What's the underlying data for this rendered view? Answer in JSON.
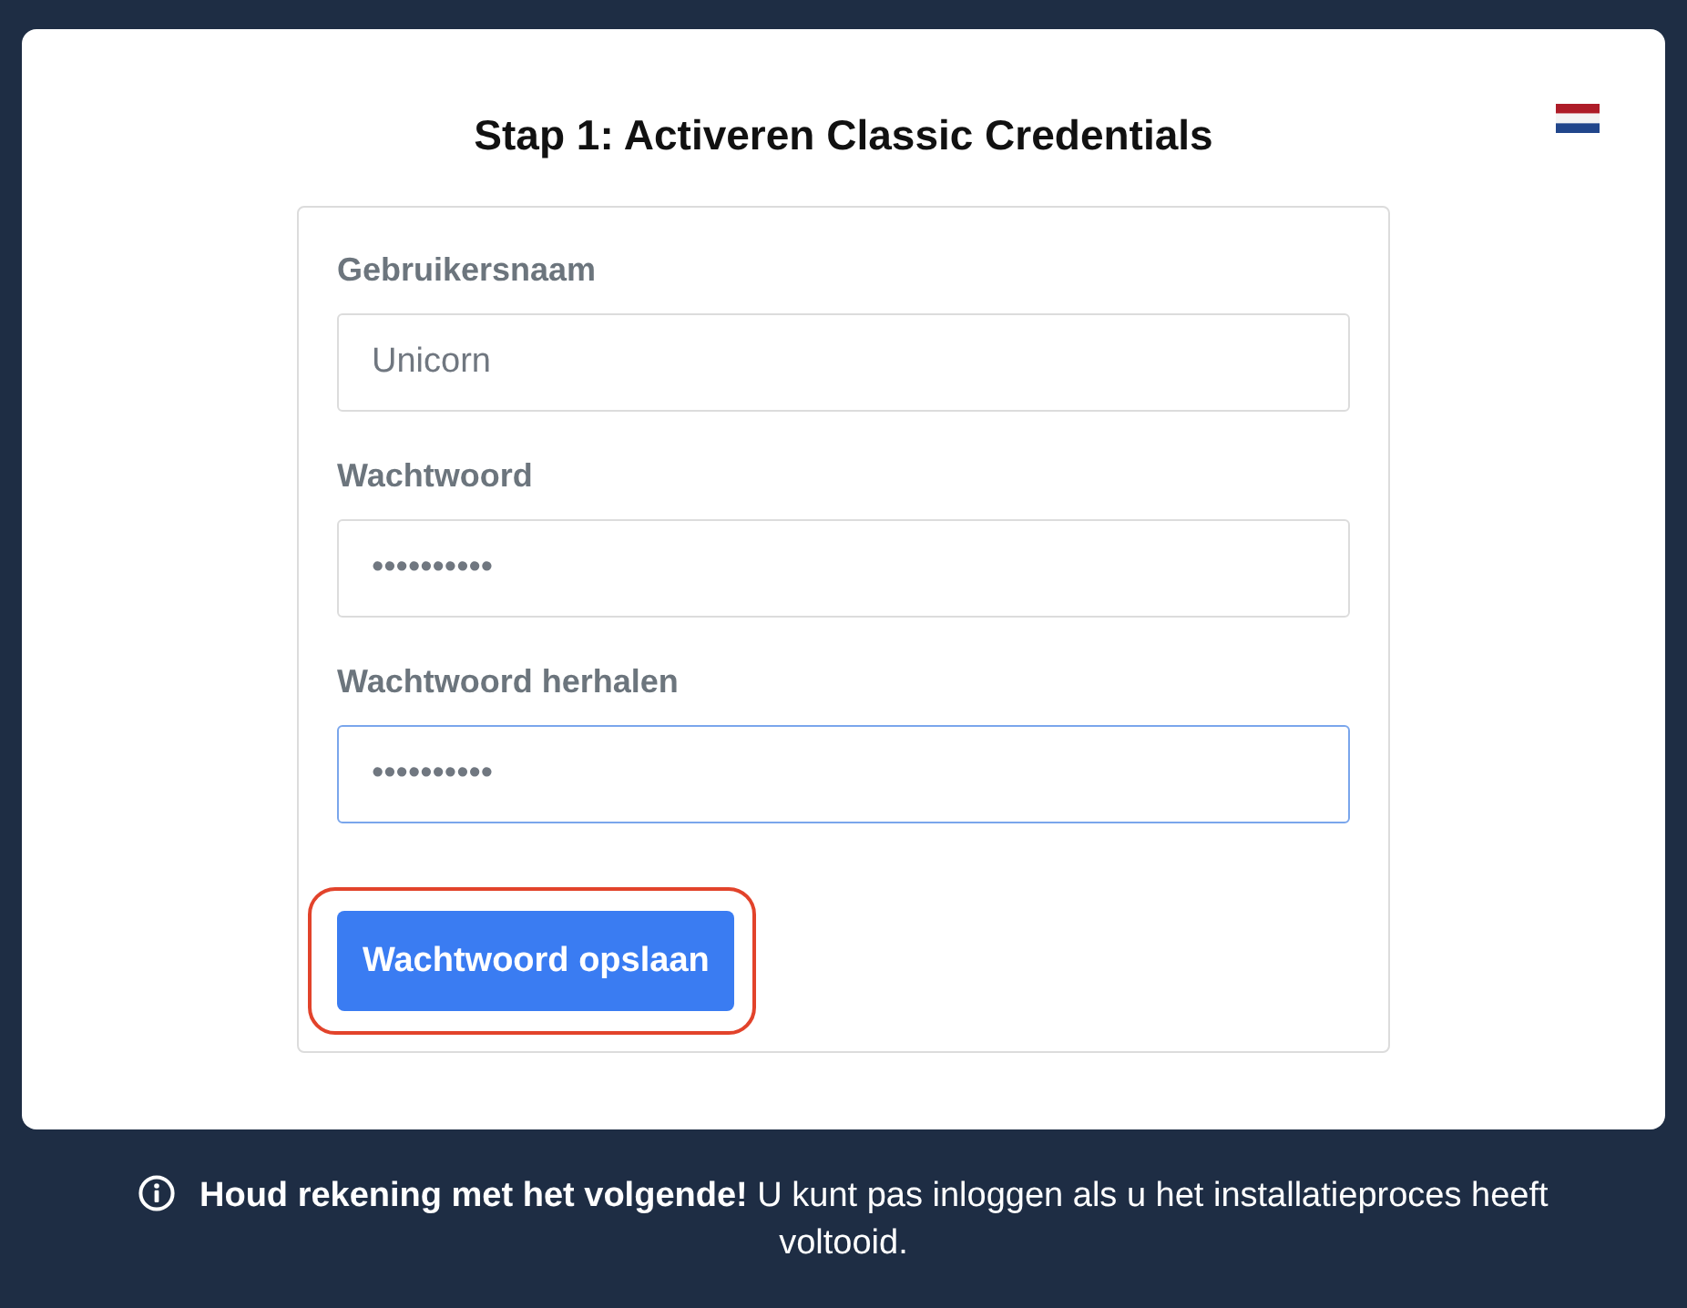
{
  "title": "Stap 1: Activeren Classic Credentials",
  "form": {
    "fields": [
      {
        "label": "Gebruikersnaam",
        "value": "Unicorn",
        "focused": false
      },
      {
        "label": "Wachtwoord",
        "value": "••••••••••",
        "focused": false
      },
      {
        "label": "Wachtwoord herhalen",
        "value": "••••••••••",
        "focused": true
      }
    ],
    "submit": {
      "label": "Wachtwoord opslaan",
      "highlighted": true
    }
  },
  "notice": {
    "text": "**Houd rekening met het volgende!** U kunt pas inloggen als u het installatieproces heeft voltooid."
  }
}
